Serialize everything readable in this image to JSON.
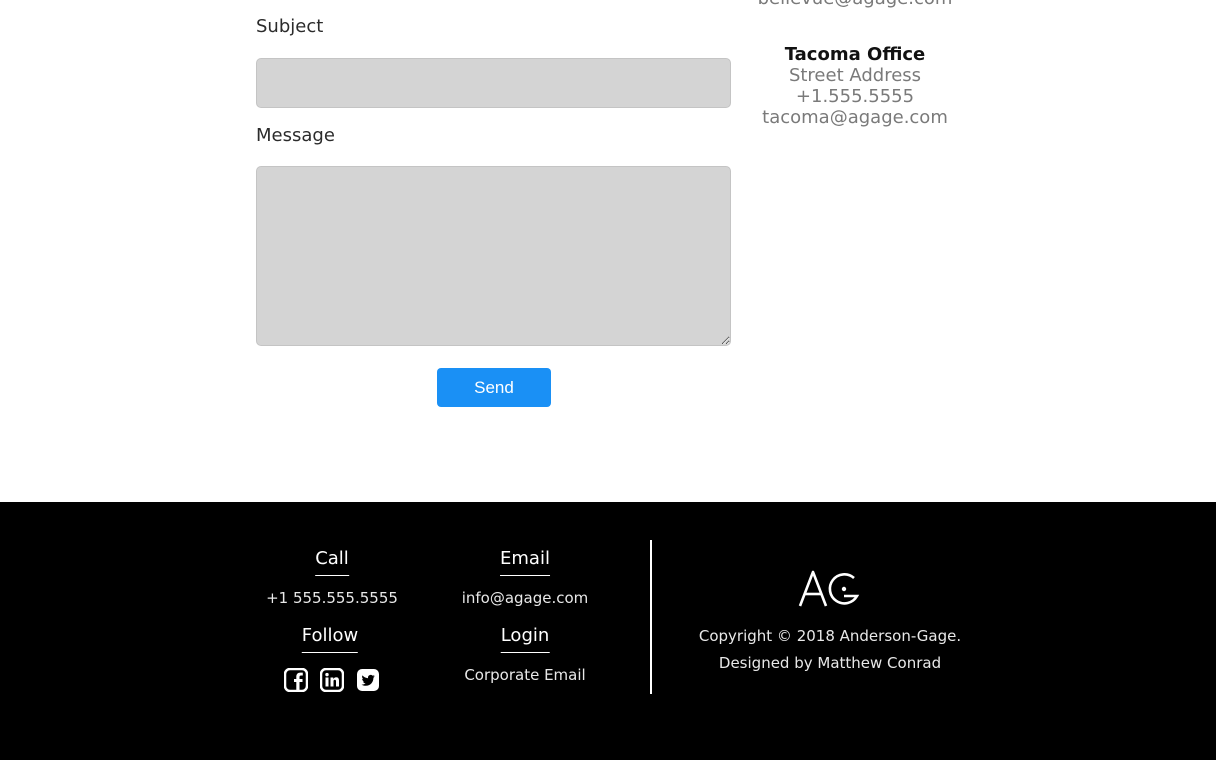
{
  "form": {
    "subject_label": "Subject",
    "subject_value": "",
    "message_label": "Message",
    "message_value": "",
    "send_label": "Send"
  },
  "offices": {
    "bellevue_email": "bellevue@agage.com",
    "tacoma": {
      "name": "Tacoma Office",
      "address": "Street Address",
      "phone": "+1.555.5555",
      "email": "tacoma@agage.com"
    }
  },
  "footer": {
    "call": {
      "heading": "Call",
      "value": "+1 555.555.5555"
    },
    "email": {
      "heading": "Email",
      "value": "info@agage.com"
    },
    "follow": {
      "heading": "Follow",
      "icons": [
        "facebook-icon",
        "linkedin-icon",
        "twitter-icon"
      ]
    },
    "login": {
      "heading": "Login",
      "link": "Corporate Email"
    },
    "logo_text": "AG",
    "copyright": "Copyright © 2018 Anderson-Gage.",
    "designer": "Designed by Matthew Conrad"
  },
  "colors": {
    "accent": "#1a90f5",
    "field_bg": "#d4d4d4",
    "footer_bg": "#000000"
  }
}
